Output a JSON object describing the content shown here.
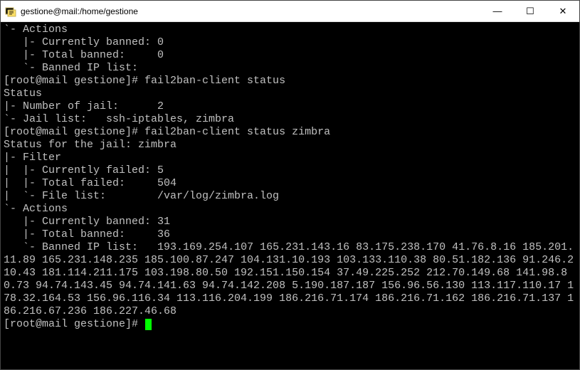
{
  "window": {
    "title": "gestione@mail:/home/gestione",
    "controls": {
      "minimize": "—",
      "maximize": "☐",
      "close": "✕"
    }
  },
  "terminal": {
    "lines": [
      "`- Actions",
      "   |- Currently banned: 0",
      "   |- Total banned:     0",
      "   `- Banned IP list:",
      "[root@mail gestione]# fail2ban-client status",
      "Status",
      "|- Number of jail:      2",
      "`- Jail list:   ssh-iptables, zimbra",
      "[root@mail gestione]# fail2ban-client status zimbra",
      "Status for the jail: zimbra",
      "|- Filter",
      "|  |- Currently failed: 5",
      "|  |- Total failed:     504",
      "|  `- File list:        /var/log/zimbra.log",
      "`- Actions",
      "   |- Currently banned: 31",
      "   |- Total banned:     36",
      "   `- Banned IP list:   193.169.254.107 165.231.143.16 83.175.238.170 41.76.8.16 185.201.11.89 165.231.148.235 185.100.87.247 104.131.10.193 103.133.110.38 80.51.182.136 91.246.210.43 181.114.211.175 103.198.80.50 192.151.150.154 37.49.225.252 212.70.149.68 141.98.80.73 94.74.143.45 94.74.141.63 94.74.142.208 5.190.187.187 156.96.56.130 113.117.110.17 178.32.164.53 156.96.116.34 113.116.204.199 186.216.71.174 186.216.71.162 186.216.71.137 186.216.67.236 186.227.46.68"
    ],
    "prompt": "[root@mail gestione]# "
  }
}
